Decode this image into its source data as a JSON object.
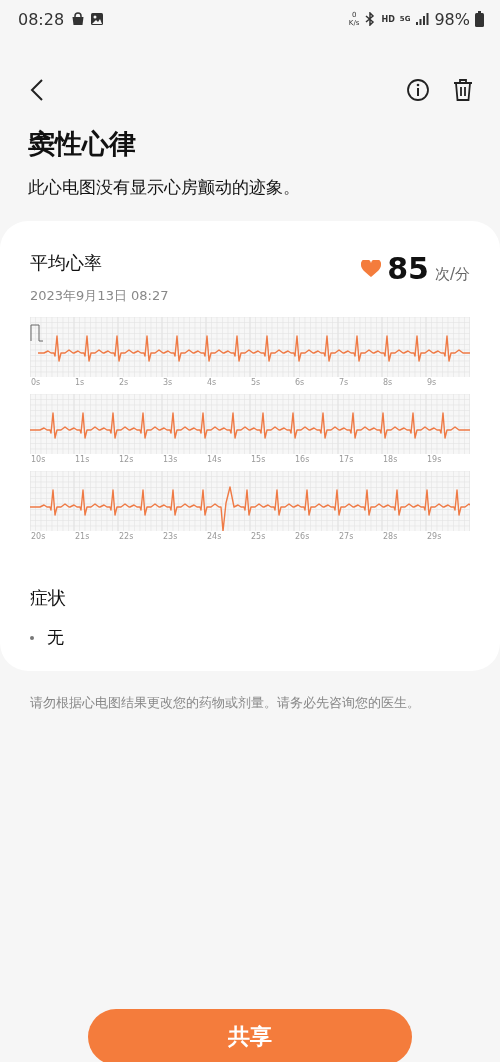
{
  "status_bar": {
    "time": "08:28",
    "net_speed_value": "0",
    "net_speed_unit": "K/s",
    "hd": "HD",
    "network": "5G",
    "battery": "98%"
  },
  "header": {
    "title": "窦性心律",
    "subtitle": "此心电图没有显示心房颤动的迹象。"
  },
  "card": {
    "heading": "平均心率",
    "date": "2023年9月13日 08:27",
    "heart_rate": "85",
    "unit": "次/分",
    "strips": [
      {
        "tick_labels": [
          "0s",
          "1s",
          "2s",
          "3s",
          "4s",
          "5s",
          "6s",
          "7s",
          "8s",
          "9s"
        ]
      },
      {
        "tick_labels": [
          "10s",
          "11s",
          "12s",
          "13s",
          "14s",
          "15s",
          "16s",
          "17s",
          "18s",
          "19s"
        ]
      },
      {
        "tick_labels": [
          "20s",
          "21s",
          "22s",
          "23s",
          "24s",
          "25s",
          "26s",
          "27s",
          "28s",
          "29s"
        ]
      }
    ],
    "symptoms_heading": "症状",
    "symptoms": [
      "无"
    ]
  },
  "disclaimer": "请勿根据心电图结果更改您的药物或剂量。请务必先咨询您的医生。",
  "share_button": "共享"
}
